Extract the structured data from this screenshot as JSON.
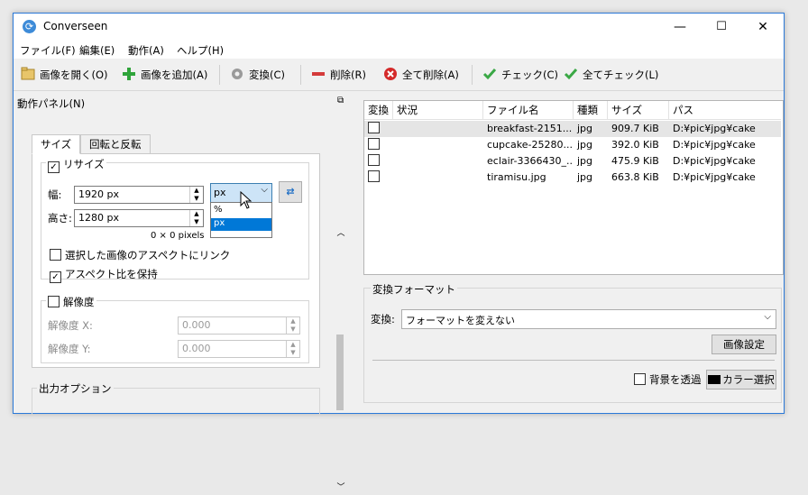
{
  "window": {
    "title": "Converseen",
    "minimize": "—",
    "maximize": "☐",
    "close": "✕"
  },
  "menu": [
    "ファイル(F)",
    "編集(E)",
    "動作(A)",
    "ヘルプ(H)"
  ],
  "toolbar": {
    "open": "画像を開く(O)",
    "add": "画像を追加(A)",
    "convert": "変換(C)",
    "delete": "削除(R)",
    "delete_all": "全て削除(A)",
    "check": "チェック(C)",
    "check_all": "全てチェック(L)"
  },
  "panel": {
    "title": "動作パネル(N)",
    "tabs": [
      "サイズ",
      "回転と反転"
    ],
    "resize": {
      "label": "リサイズ",
      "checked": true,
      "width_label": "幅:",
      "width_value": "1920 px",
      "height_label": "高さ:",
      "height_value": "1280 px",
      "unit_selected": "px",
      "unit_options": [
        "%",
        "px"
      ],
      "pixels_info": "0 × 0 pixels",
      "link_aspect_label": "選択した画像のアスペクトにリンク",
      "link_aspect_checked": false,
      "keep_aspect_label": "アスペクト比を保持",
      "keep_aspect_checked": true
    },
    "resolution": {
      "label": "解像度",
      "checked": false,
      "x_label": "解像度 X:",
      "x_value": "0.000",
      "y_label": "解像度 Y:",
      "y_value": "0.000"
    },
    "output_options": "出力オプション"
  },
  "table": {
    "columns": [
      "変換",
      "状況",
      "ファイル名",
      "種類",
      "サイズ",
      "パス"
    ],
    "rows": [
      {
        "filename": "breakfast-2151...",
        "type": "jpg",
        "size": "909.7 KiB",
        "path": "D:¥pic¥jpg¥cake",
        "checked": false
      },
      {
        "filename": "cupcake-25280...",
        "type": "jpg",
        "size": "392.0 KiB",
        "path": "D:¥pic¥jpg¥cake",
        "checked": false
      },
      {
        "filename": "eclair-3366430_...",
        "type": "jpg",
        "size": "475.9 KiB",
        "path": "D:¥pic¥jpg¥cake",
        "checked": false
      },
      {
        "filename": "tiramisu.jpg",
        "type": "jpg",
        "size": "663.8 KiB",
        "path": "D:¥pic¥jpg¥cake",
        "checked": false
      }
    ]
  },
  "format": {
    "group_label": "変換フォーマット",
    "convert_label": "変換:",
    "format_value": "フォーマットを変えない",
    "image_settings": "画像設定",
    "transparent_bg_label": "背景を透過",
    "transparent_bg_checked": false,
    "color_select": "カラー選択",
    "color_swatch": "#000000"
  },
  "colors": {
    "accent": "#2b79d8",
    "selection": "#0078d7",
    "selected_row": "#e5e5e5"
  }
}
